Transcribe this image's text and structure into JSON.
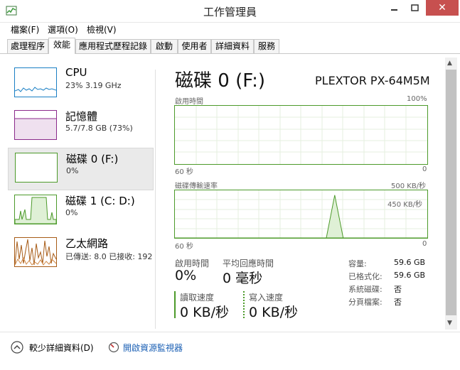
{
  "window": {
    "title": "工作管理員"
  },
  "menu": {
    "items": [
      "檔案(F)",
      "選項(O)",
      "檢視(V)"
    ]
  },
  "tabs": [
    {
      "label": "處理程序"
    },
    {
      "label": "效能"
    },
    {
      "label": "應用程式歷程記錄"
    },
    {
      "label": "啟動"
    },
    {
      "label": "使用者"
    },
    {
      "label": "詳細資料"
    },
    {
      "label": "服務"
    }
  ],
  "sidebar": {
    "items": [
      {
        "title": "CPU",
        "sub": "23%  3.19 GHz",
        "color": "#1a7fc4"
      },
      {
        "title": "記憶體",
        "sub": "5.7/7.8 GB (73%)",
        "color": "#8b2a8b"
      },
      {
        "title": "磁碟 0 (F:)",
        "sub": "0%",
        "color": "#4c9a2a"
      },
      {
        "title": "磁碟 1 (C: D:)",
        "sub": "0%",
        "color": "#4c9a2a"
      },
      {
        "title": "乙太網路",
        "sub": "已傳送: 8.0  已接收: 192",
        "color": "#a75b16"
      }
    ]
  },
  "main": {
    "title": "磁碟 0 (F:)",
    "model": "PLEXTOR PX-64M5M",
    "chart1": {
      "label_left": "啟用時間",
      "label_right": "100%",
      "bottom_left": "60 秒",
      "bottom_right": "0"
    },
    "chart2": {
      "label_left": "磁碟傳輸速率",
      "label_right": "500 KB/秒",
      "inner_label": "450 KB/秒",
      "bottom_left": "60 秒",
      "bottom_right": "0"
    },
    "stats": {
      "active_label": "啟用時間",
      "active_value": "0%",
      "response_label": "平均回應時間",
      "response_value": "0 毫秒",
      "read_label": "讀取速度",
      "read_value": "0 KB/秒",
      "write_label": "寫入速度",
      "write_value": "0 KB/秒"
    },
    "props": [
      {
        "key": "容量:",
        "value": "59.6 GB"
      },
      {
        "key": "已格式化:",
        "value": "59.6 GB"
      },
      {
        "key": "系統磁碟:",
        "value": "否"
      },
      {
        "key": "分頁檔案:",
        "value": "否"
      }
    ]
  },
  "footer": {
    "less_details": "較少詳細資料(D)",
    "open_monitor": "開啟資源監視器"
  },
  "chart_data": {
    "type": "line",
    "ylim": [
      0,
      500
    ],
    "ylabel": "磁碟傳輸速率",
    "series": [
      {
        "x": [
          0,
          36,
          38,
          40,
          60
        ],
        "values": [
          0,
          0,
          450,
          0,
          0
        ]
      }
    ]
  }
}
